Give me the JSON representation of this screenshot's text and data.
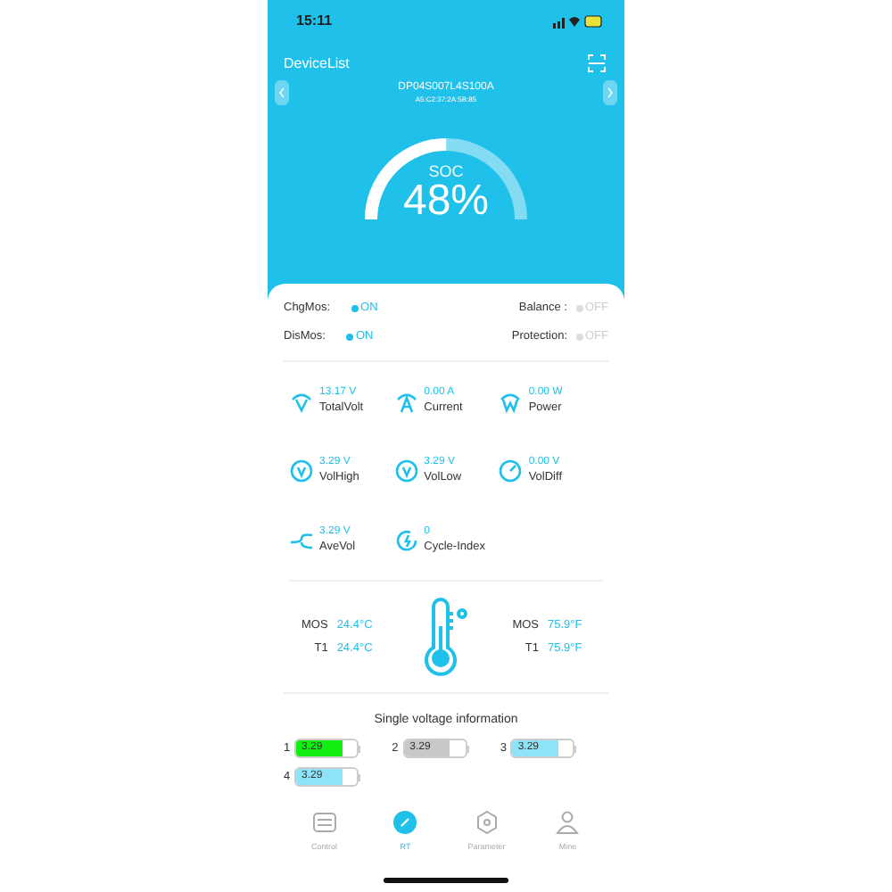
{
  "status_bar": {
    "time": "15:11"
  },
  "header": {
    "title": "DeviceList",
    "device_name": "DP04S007L4S100A",
    "device_address": "A5:C2:37:2A:5B:85"
  },
  "gauge": {
    "label": "SOC",
    "value": "48%"
  },
  "switches": [
    {
      "label": "ChgMos:",
      "state": "ON",
      "on": true
    },
    {
      "label": "Balance :",
      "state": "OFF",
      "on": false
    },
    {
      "label": "DisMos:",
      "state": "ON",
      "on": true
    },
    {
      "label": "Protection:",
      "state": "OFF",
      "on": false
    }
  ],
  "metrics": [
    {
      "kind": "volt",
      "value": "13.17 V",
      "label": "TotalVolt"
    },
    {
      "kind": "current",
      "value": "0.00 A",
      "label": "Current"
    },
    {
      "kind": "power",
      "value": "0.00 W",
      "label": "Power"
    },
    {
      "kind": "high",
      "value": "3.29 V",
      "label": "VolHigh"
    },
    {
      "kind": "low",
      "value": "3.29 V",
      "label": "VolLow"
    },
    {
      "kind": "diff",
      "value": "0.00 V",
      "label": "VolDiff"
    },
    {
      "kind": "ave",
      "value": "3.29 V",
      "label": "AveVol"
    },
    {
      "kind": "cycle",
      "value": "0",
      "label": "Cycle-Index"
    }
  ],
  "temperatures": {
    "celsius": [
      {
        "label": "MOS",
        "value": "24.4°C"
      },
      {
        "label": "T1",
        "value": "24.4°C"
      }
    ],
    "fahrenheit": [
      {
        "label": "MOS",
        "value": "75.9°F"
      },
      {
        "label": "T1",
        "value": "75.9°F"
      }
    ]
  },
  "cells": {
    "title": "Single voltage information",
    "items": [
      {
        "index": "1",
        "value": "3.29",
        "level": 0.75,
        "color": "#11ee11"
      },
      {
        "index": "2",
        "value": "3.29",
        "level": 0.75,
        "color": "#c8c8c8"
      },
      {
        "index": "3",
        "value": "3.29",
        "level": 0.75,
        "color": "#8fe3f8"
      },
      {
        "index": "4",
        "value": "3.29",
        "level": 0.75,
        "color": "#8fe3f8"
      }
    ]
  },
  "tab_bar": [
    {
      "kind": "control",
      "label": "Control",
      "selected": false
    },
    {
      "kind": "rt",
      "label": "RT",
      "selected": true
    },
    {
      "kind": "parameter",
      "label": "Parameter",
      "selected": false
    },
    {
      "kind": "mine",
      "label": "Mine",
      "selected": false
    }
  ]
}
